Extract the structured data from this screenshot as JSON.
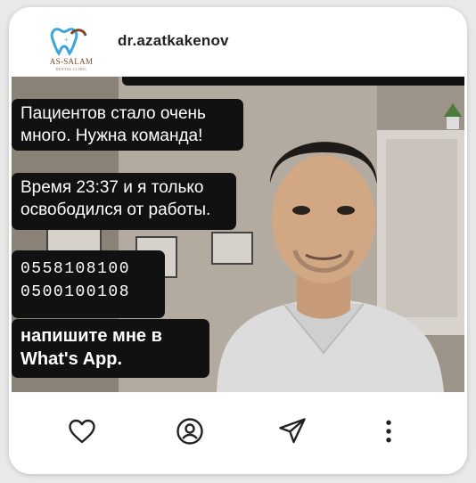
{
  "post": {
    "username": "dr.azatkakenov",
    "logo": {
      "name": "AS-SALAM",
      "sub": "DENTAL CLINIC"
    },
    "overlay_text": [
      "Пациентов стало очень много. Нужна команда!",
      "Время 23:37 и я только освободился от работы.",
      "0558108100 0500100108",
      "напишите мне в What's App."
    ]
  },
  "actions": {
    "like_icon": "heart-icon",
    "profile_icon": "user-circle-icon",
    "share_icon": "paper-plane-icon",
    "more_icon": "more-vertical-icon"
  }
}
